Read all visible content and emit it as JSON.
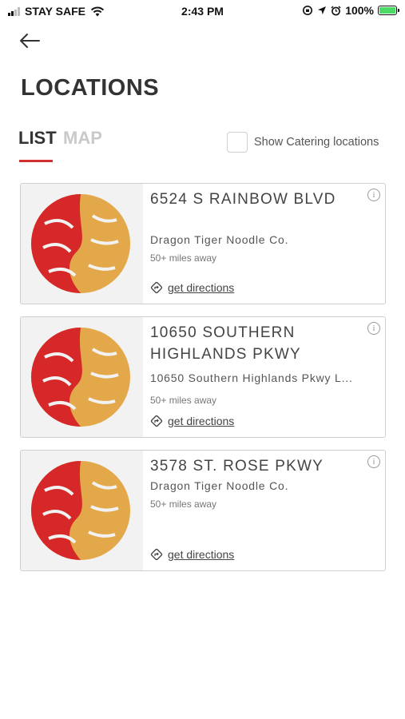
{
  "status_bar": {
    "carrier": "STAY SAFE",
    "time": "2:43 PM",
    "battery": "100%"
  },
  "header": {
    "title": "LOCATIONS"
  },
  "tabs": [
    {
      "label": "LIST",
      "active": true
    },
    {
      "label": "MAP",
      "active": false
    }
  ],
  "catering": {
    "label": "Show Catering locations",
    "checked": false
  },
  "colors": {
    "accent": "#d32f2f",
    "logo_red": "#d62828",
    "logo_gold": "#e3a84a",
    "battery_green": "#4cd964"
  },
  "locations": [
    {
      "title": "6524 S RAINBOW BLVD",
      "subtitle": "Dragon Tiger Noodle Co.",
      "distance": "50+ miles away",
      "directions_label": "get directions"
    },
    {
      "title": "10650 SOUTHERN HIGHLANDS PKWY",
      "subtitle": "10650 Southern Highlands Pkwy L...",
      "distance": "50+ miles away",
      "directions_label": "get directions"
    },
    {
      "title": "3578 ST. ROSE PKWY",
      "subtitle": "Dragon Tiger Noodle Co.",
      "distance": "50+ miles away",
      "directions_label": "get directions"
    }
  ]
}
